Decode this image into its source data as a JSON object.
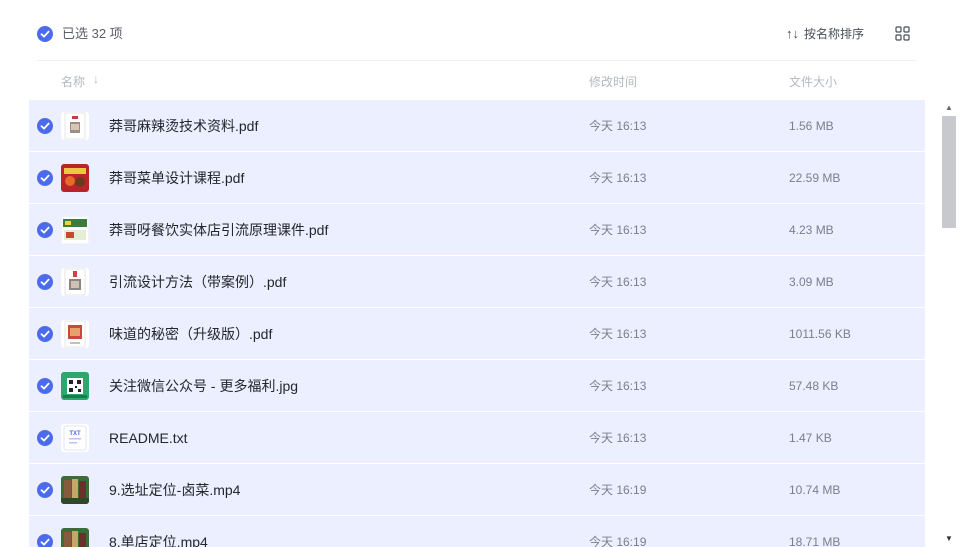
{
  "toolbar": {
    "selected_text": "已选 32 项",
    "sort_arrows": "↑↓",
    "sort_label": "按名称排序"
  },
  "columns": {
    "name": "名称",
    "name_sort_arrow": "↓",
    "time": "修改时间",
    "size": "文件大小"
  },
  "colors": {
    "accent": "#4c6bea",
    "row_selected": "#ebefff"
  },
  "files": [
    {
      "name": "莽哥麻辣烫技术资料.pdf",
      "time": "今天 16:13",
      "size": "1.56 MB",
      "icon": "pdf-thumbnail-icon"
    },
    {
      "name": "莽哥菜单设计课程.pdf",
      "time": "今天 16:13",
      "size": "22.59 MB",
      "icon": "pdf-thumbnail-icon"
    },
    {
      "name": "莽哥呀餐饮实体店引流原理课件.pdf",
      "time": "今天 16:13",
      "size": "4.23 MB",
      "icon": "pdf-thumbnail-icon"
    },
    {
      "name": "引流设计方法（带案例）.pdf",
      "time": "今天 16:13",
      "size": "3.09 MB",
      "icon": "pdf-thumbnail-icon"
    },
    {
      "name": "味道的秘密（升级版）.pdf",
      "time": "今天 16:13",
      "size": "1011.56 KB",
      "icon": "pdf-thumbnail-icon"
    },
    {
      "name": "关注微信公众号 - 更多福利.jpg",
      "time": "今天 16:13",
      "size": "57.48 KB",
      "icon": "qr-image-thumbnail-icon"
    },
    {
      "name": "README.txt",
      "time": "今天 16:13",
      "size": "1.47 KB",
      "icon": "txt-file-icon",
      "icon_text": "TXT"
    },
    {
      "name": "9.选址定位-卤菜.mp4",
      "time": "今天 16:19",
      "size": "10.74 MB",
      "icon": "video-thumbnail-icon"
    },
    {
      "name": "8.单店定位.mp4",
      "time": "今天 16:19",
      "size": "18.71 MB",
      "icon": "video-thumbnail-icon"
    }
  ]
}
